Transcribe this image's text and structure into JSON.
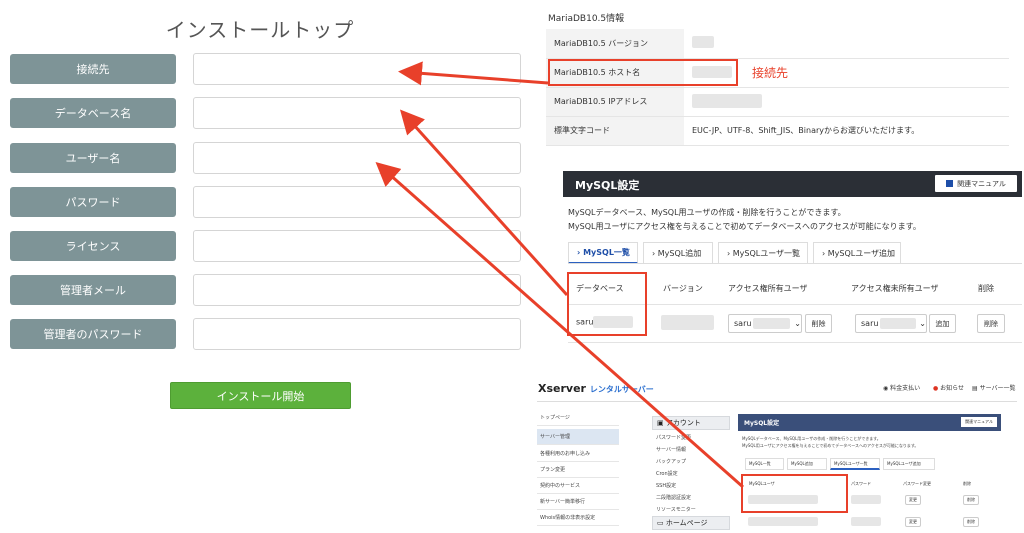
{
  "install_form": {
    "title": "インストールトップ",
    "fields": [
      {
        "label": "接続先"
      },
      {
        "label": "データベース名"
      },
      {
        "label": "ユーザー名"
      },
      {
        "label": "パスワード"
      },
      {
        "label": "ライセンス"
      },
      {
        "label": "管理者メール"
      },
      {
        "label": "管理者のパスワード"
      }
    ],
    "submit_label": "インストール開始"
  },
  "mariadb_info": {
    "title": "MariaDB10.5情報",
    "rows": [
      {
        "label": "MariaDB10.5 バージョン",
        "value": ""
      },
      {
        "label": "MariaDB10.5 ホスト名",
        "value": ""
      },
      {
        "label": "MariaDB10.5 IPアドレス",
        "value": ""
      },
      {
        "label": "標準文字コード",
        "value": "EUC-JP、UTF-8、Shift_JIS、Binaryからお選びいただけます。"
      }
    ],
    "annotation": "接続先"
  },
  "mysql_settings": {
    "title": "MySQL設定",
    "manual_button": "関連マニュアル",
    "description_1": "MySQLデータベース、MySQL用ユーザの作成・削除を行うことができます。",
    "description_2": "MySQL用ユーザにアクセス権を与えることで初めてデータベースへのアクセスが可能になります。",
    "tabs": [
      "MySQL一覧",
      "MySQL追加",
      "MySQLユーザ一覧",
      "MySQLユーザ追加"
    ],
    "columns": [
      "データベース",
      "バージョン",
      "アクセス権所有ユーザ",
      "アクセス権未所有ユーザ",
      "削除"
    ],
    "row": {
      "database": "saru",
      "owner_user": "saru",
      "non_owner_user": "saru",
      "delete_owner": "削除",
      "add": "追加",
      "delete": "削除"
    }
  },
  "xserver_panel": {
    "logo": "Xserver",
    "logo_sub": "レンタルサーバー",
    "top_links": [
      "料金支払い",
      "お知らせ",
      "サーバー一覧"
    ],
    "side_items": [
      "トップページ",
      "サーバー管理",
      "各種利用のお申し込み",
      "プラン変更",
      "契約中のサービス",
      "新サーバー簡単移行",
      "Whois情報の非表示設定"
    ],
    "mid_head": "アカウント",
    "mid_items": [
      "パスワード変更",
      "サーバー情報",
      "バックアップ",
      "Cron設定",
      "SSH設定",
      "二段階認証設定",
      "リソースモニター"
    ],
    "mid_head2": "ホームページ",
    "panel_title": "MySQL設定",
    "panel_manual": "関連マニュアル",
    "panel_desc_1": "MySQLデータベース、MySQL用ユーザの作成・削除を行うことができます。",
    "panel_desc_2": "MySQL用ユーザにアクセス権を与えることで初めてデータベースへのアクセスが可能になります。",
    "panel_tabs": [
      "MySQL一覧",
      "MySQL追加",
      "MySQLユーザ一覧",
      "MySQLユーザ追加"
    ],
    "panel_columns": [
      "MySQLユーザ",
      "パスワード",
      "パスワード変更",
      "削除"
    ],
    "change_label": "変更",
    "delete_label": "削除"
  }
}
